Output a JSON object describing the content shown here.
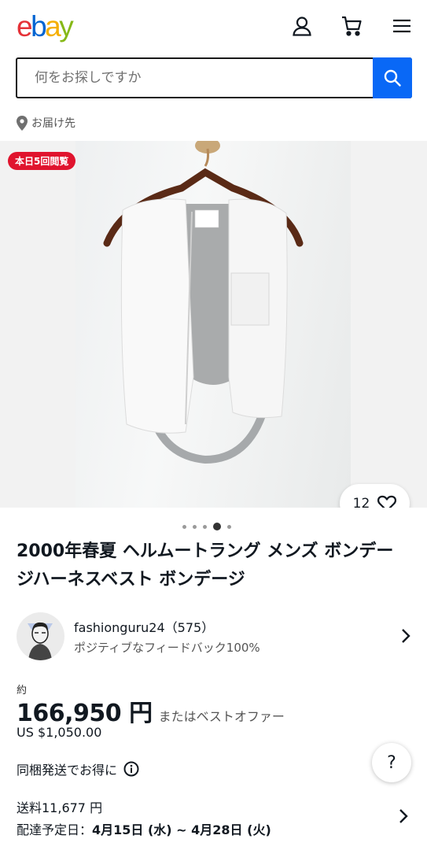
{
  "header": {
    "logo": {
      "e": "e",
      "b": "b",
      "a": "a",
      "y": "y"
    },
    "icons": [
      "user-icon",
      "cart-icon",
      "menu-icon"
    ]
  },
  "search": {
    "placeholder": "何をお探しですか",
    "button_icon": "search-icon"
  },
  "deliver_to": "お届け先",
  "badge": "本日5回閲覧",
  "watch_count": "12",
  "gallery": {
    "current_index": 4,
    "total": 5
  },
  "title": "2000年春夏 ヘルムートラング メンズ ボンデージハーネスベスト ボンデージ",
  "seller": {
    "name": "fashionguru24（575）",
    "feedback": "ポジティブなフィードバック100%"
  },
  "price": {
    "approx": "約",
    "jpy": "166,950 円",
    "offer": "またはベストオファー",
    "usd": "US $1,050.00"
  },
  "combined_shipping": "同梱発送でお得に",
  "help": "?",
  "shipping": {
    "cost": "送料11,677 円",
    "eta_label": "配達予定日：",
    "eta_value": "4月15日 (水) ~ 4月28日 (火)"
  },
  "colors": {
    "accent": "#0968f6",
    "badge": "#e0142e",
    "logo_e": "#e53238",
    "logo_b": "#0064d2",
    "logo_a": "#f5af02",
    "logo_y": "#86b817"
  }
}
